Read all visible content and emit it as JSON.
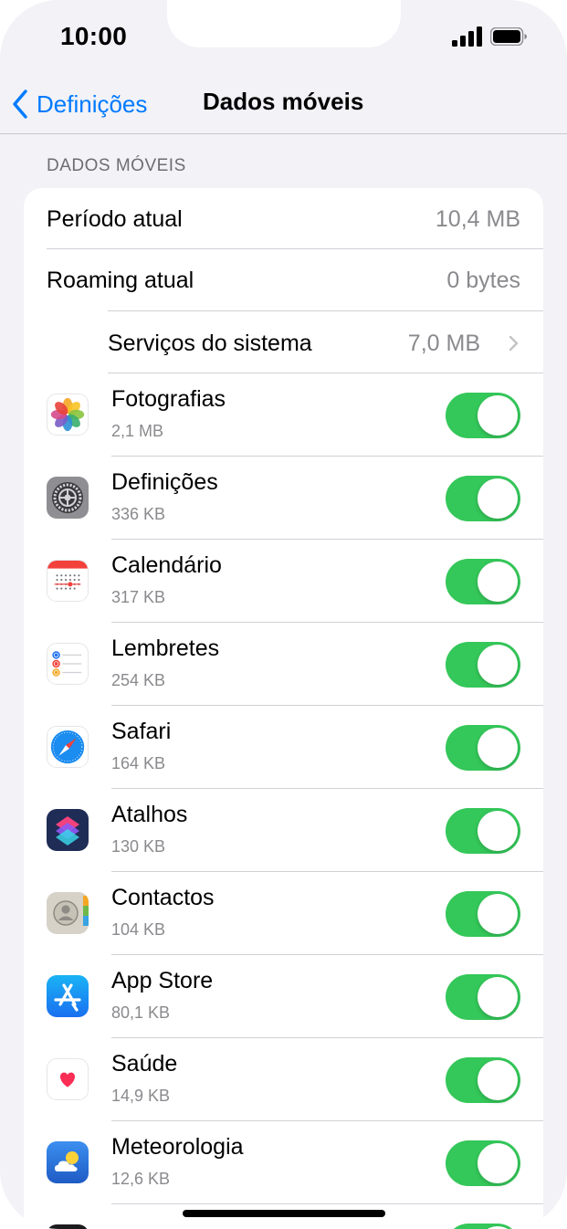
{
  "status": {
    "time": "10:00"
  },
  "nav": {
    "back_label": "Definições",
    "title": "Dados móveis"
  },
  "section_header": "DADOS MÓVEIS",
  "summary": [
    {
      "label": "Período atual",
      "value": "10,4 MB"
    },
    {
      "label": "Roaming atual",
      "value": "0 bytes"
    }
  ],
  "system_services": {
    "label": "Serviços do sistema",
    "value": "7,0 MB"
  },
  "apps": [
    {
      "name": "Fotografias",
      "size": "2,1 MB",
      "enabled": true,
      "icon": "photos-icon"
    },
    {
      "name": "Definições",
      "size": "336 KB",
      "enabled": true,
      "icon": "settings-icon"
    },
    {
      "name": "Calendário",
      "size": "317 KB",
      "enabled": true,
      "icon": "calendar-icon"
    },
    {
      "name": "Lembretes",
      "size": "254 KB",
      "enabled": true,
      "icon": "reminders-icon"
    },
    {
      "name": "Safari",
      "size": "164 KB",
      "enabled": true,
      "icon": "safari-icon"
    },
    {
      "name": "Atalhos",
      "size": "130 KB",
      "enabled": true,
      "icon": "shortcuts-icon"
    },
    {
      "name": "Contactos",
      "size": "104 KB",
      "enabled": true,
      "icon": "contacts-icon"
    },
    {
      "name": "App Store",
      "size": "80,1 KB",
      "enabled": true,
      "icon": "app-store-icon"
    },
    {
      "name": "Saúde",
      "size": "14,9 KB",
      "enabled": true,
      "icon": "health-icon"
    },
    {
      "name": "Meteorologia",
      "size": "12,6 KB",
      "enabled": true,
      "icon": "weather-icon"
    }
  ],
  "colors": {
    "accent": "#007aff",
    "toggle_on": "#34c759"
  }
}
